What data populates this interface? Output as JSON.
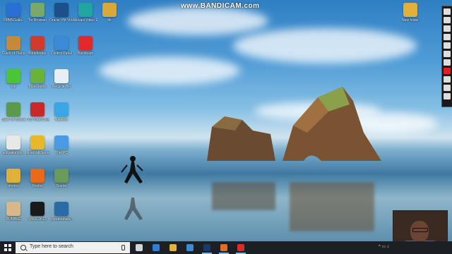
{
  "watermark": "www.BANDICAM.com",
  "desktop_icons": [
    {
      "name": "icon-xmmsgalla",
      "label": "XMMSGalla..",
      "color": "#2a6fd6",
      "col": 0,
      "row": 0
    },
    {
      "name": "icon-tor-browser",
      "label": "Tor Browser",
      "color": "#7aa86b",
      "col": 1,
      "row": 0
    },
    {
      "name": "icon-oracle-vm",
      "label": "Oracle VM VirtualBox (1)",
      "color": "#1d4f8a",
      "col": 2,
      "row": 0
    },
    {
      "name": "icon-movavi",
      "label": "Movavi Video Edito...",
      "color": "#1fa6a0",
      "col": 3,
      "row": 0
    },
    {
      "name": "icon-hk",
      "label": "hk",
      "color": "#d8a93a",
      "col": 4,
      "row": 0
    },
    {
      "name": "icon-clash-of-clans",
      "label": "Clash of Clans",
      "color": "#c28a3a",
      "col": 0,
      "row": 1
    },
    {
      "name": "icon-bitdefender",
      "label": "Bitdefender",
      "color": "#d23a2a",
      "col": 1,
      "row": 1
    },
    {
      "name": "icon-control-panel",
      "label": "Control Panel",
      "color": "#3a8ad6",
      "col": 2,
      "row": 1
    },
    {
      "name": "icon-bandicam",
      "label": "Bandicam",
      "color": "#e02a2a",
      "col": 3,
      "row": 1
    },
    {
      "name": "icon-kik",
      "label": "Kik",
      "color": "#4cc43a",
      "col": 0,
      "row": 2
    },
    {
      "name": "icon-bluestacks",
      "label": "BlueStacks",
      "color": "#6ab33a",
      "col": 1,
      "row": 2
    },
    {
      "name": "icon-recycle-bin",
      "label": "Recycle Bin",
      "color": "#e8eef4",
      "col": 2,
      "row": 2
    },
    {
      "name": "icon-start-tor-browser",
      "label": "Start Tor Browser",
      "color": "#5a9a4a",
      "col": 0,
      "row": 3
    },
    {
      "name": "icon-tiktok-video-downloader",
      "label": "TYD Video Downloader",
      "color": "#c82a2a",
      "col": 1,
      "row": 3
    },
    {
      "name": "icon-network",
      "label": "Network",
      "color": "#3aa6e6",
      "col": 2,
      "row": 3
    },
    {
      "name": "icon-activation",
      "label": "activation.ps..",
      "color": "#e8e8e8",
      "col": 0,
      "row": 4
    },
    {
      "name": "icon-minecraft-server",
      "label": "Minecraft Server",
      "color": "#e8b82a",
      "col": 1,
      "row": 4
    },
    {
      "name": "icon-this-pc",
      "label": "This PC",
      "color": "#4a9ae6",
      "col": 2,
      "row": 4
    },
    {
      "name": "icon-photos",
      "label": "photos",
      "color": "#e0b03a",
      "col": 0,
      "row": 5
    },
    {
      "name": "icon-firefox",
      "label": "Firefox",
      "color": "#e86a1a",
      "col": 1,
      "row": 5
    },
    {
      "name": "icon-sambel",
      "label": "Snelre",
      "color": "#6a9a5a",
      "col": 2,
      "row": 5
    },
    {
      "name": "icon-rumbles",
      "label": "RUMBLE",
      "color": "#d8b88a",
      "col": 0,
      "row": 6
    },
    {
      "name": "icon-wwe-2k18",
      "label": "WWE 2K18",
      "color": "#1a1a1a",
      "col": 1,
      "row": 6
    },
    {
      "name": "icon-wondershare-filmora",
      "label": "Wondershare Filmora",
      "color": "#2a6aa6",
      "col": 2,
      "row": 6
    }
  ],
  "right_icons": [
    {
      "name": "icon-new-folder",
      "label": "New folder",
      "color": "#e0b03a"
    }
  ],
  "taskbar": {
    "search_placeholder": "Type here to search",
    "apps": [
      {
        "name": "taskbar-task-view",
        "color": "#cfd6de",
        "active": false
      },
      {
        "name": "taskbar-edge",
        "color": "#2f7fd6",
        "active": false
      },
      {
        "name": "taskbar-file-explorer",
        "color": "#e2b33a",
        "active": false
      },
      {
        "name": "taskbar-store",
        "color": "#3a8ad6",
        "active": false
      },
      {
        "name": "taskbar-photoshop",
        "color": "#1b3a6a",
        "active": true
      },
      {
        "name": "taskbar-firefox",
        "color": "#e86a1a",
        "active": true
      },
      {
        "name": "taskbar-bandicam",
        "color": "#e02a2a",
        "active": true
      }
    ]
  },
  "drawbar_tools": [
    "pen",
    "pencil",
    "marker",
    "eraser",
    "shape",
    "text",
    "fill",
    "color",
    "line",
    "clear",
    "close"
  ]
}
